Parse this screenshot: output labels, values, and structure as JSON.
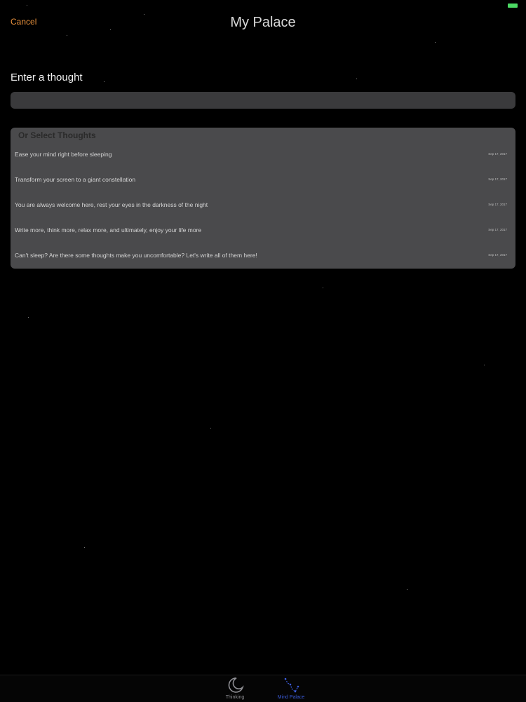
{
  "nav": {
    "cancel_label": "Cancel",
    "title": "My Palace"
  },
  "input": {
    "label": "Enter a thought",
    "value": "",
    "placeholder": ""
  },
  "thoughts": {
    "header": "Or Select Thoughts",
    "items": [
      {
        "text": "Ease your mind right before sleeping",
        "date": "Sep 17, 2017"
      },
      {
        "text": "Transform your screen to a giant constellation",
        "date": "Sep 17, 2017"
      },
      {
        "text": "You are always welcome here, rest your eyes in the darkness of the night",
        "date": "Sep 17, 2017"
      },
      {
        "text": "Write more, think more, relax more, and ultimately, enjoy your life more",
        "date": "Sep 17, 2017"
      },
      {
        "text": "Can't sleep? Are there some thoughts make you uncomfortable? Let's write all of them here!",
        "date": "Sep 17, 2017"
      }
    ]
  },
  "tabs": [
    {
      "label": "Thinking",
      "icon": "moon-icon",
      "selected": false
    },
    {
      "label": "Mind Palace",
      "icon": "constellation-icon",
      "selected": true
    }
  ],
  "colors": {
    "accent": "#e8913c",
    "tab_selected": "#3b5bd9",
    "background": "#000000",
    "panel": "#4a4a4c"
  }
}
